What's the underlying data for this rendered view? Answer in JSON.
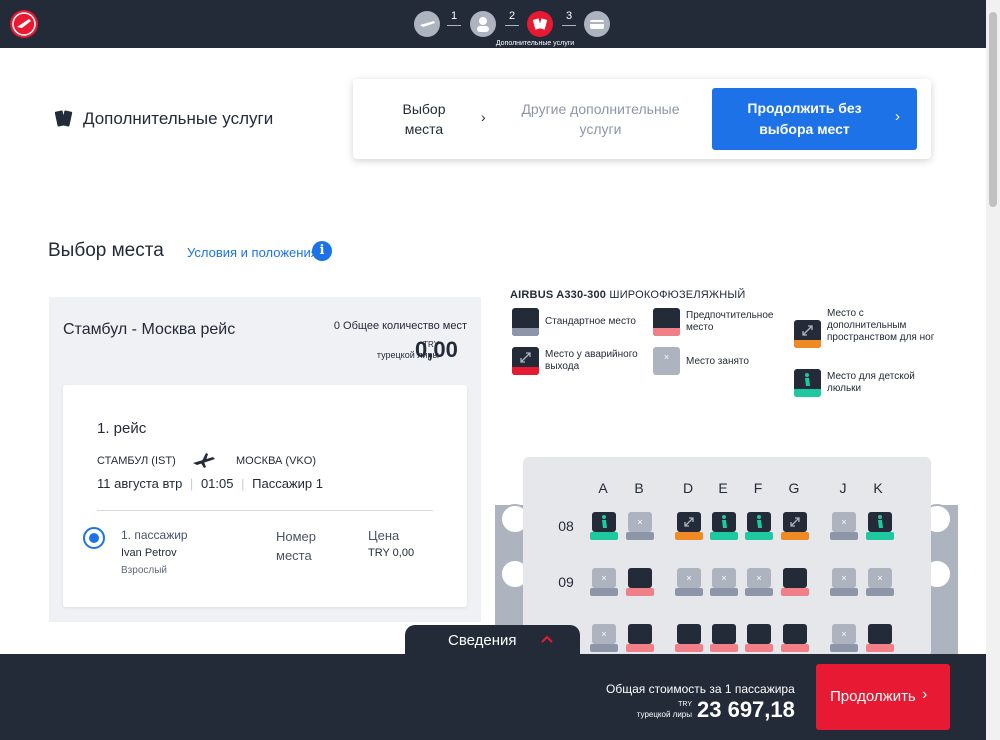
{
  "header": {
    "steps": [
      {
        "name": "flight-step-icon",
        "active": false
      },
      {
        "name": "passenger-step-icon",
        "active": false
      },
      {
        "name": "extras-step-icon",
        "active": true
      },
      {
        "name": "payment-step-icon",
        "active": false
      }
    ],
    "step_numbers": [
      "1",
      "2",
      "3"
    ],
    "active_step_label": "Дополнительные услуги"
  },
  "extras": {
    "title": "Дополнительные услуги",
    "nav_seat": "Выбор места",
    "nav_other": "Другие дополнительные услуги",
    "continue_no_seat": "Продолжить без выбора мест"
  },
  "seat": {
    "title": "Выбор места",
    "terms": "Условия и положения",
    "route_title": "Стамбул - Москва рейс",
    "total_seats": "0 Общее количество мест",
    "currency_code": "TRY",
    "currency_name": "турецкой лиры",
    "price_zero": "0,00",
    "flight": {
      "title": "1. рейс",
      "from": "СТАМБУЛ (IST)",
      "to": "МОСКВА (VKO)",
      "date": "11 августа втр",
      "time": "01:05",
      "passenger_short": "Пассажир 1"
    },
    "passenger": {
      "label": "1. пассажир",
      "name": "Ivan Petrov",
      "type": "Взрослый",
      "seat_number_label": "Номер места",
      "price_label": "Цена",
      "price_value": "TRY  0,00"
    }
  },
  "legend": {
    "aircraft": "AIRBUS A330-300",
    "aircraft_type": "ШИРОКОФЮЗЕЛЯЖНЫЙ",
    "items": [
      {
        "label": "Стандартное место",
        "color": "#8d96a8"
      },
      {
        "label": "Предпочтительное место",
        "color": "#f07f87"
      },
      {
        "label": "Место с дополнительным пространством для ног",
        "color": "#f08a24"
      },
      {
        "label": "Место у аварийного выхода",
        "color": "#e81932"
      },
      {
        "label": "Место занято",
        "color": "#aeb4bf"
      },
      {
        "label": "Место для детской люльки",
        "color": "#1ec9a0"
      }
    ]
  },
  "seat_map": {
    "columns": [
      "A",
      "B",
      "D",
      "E",
      "F",
      "G",
      "J",
      "K"
    ],
    "rows": [
      "08",
      "09"
    ]
  },
  "footer": {
    "info_tab": "Сведения",
    "total_label": "Общая стоимость за 1 пассажира",
    "total_currency_code": "TRY",
    "total_currency_name": "турецкой лиры",
    "total_value": "23 697,18",
    "continue": "Продолжить"
  },
  "colors": {
    "brand_red": "#e81932",
    "accent_blue": "#1d72e8",
    "navy": "#232b38"
  }
}
